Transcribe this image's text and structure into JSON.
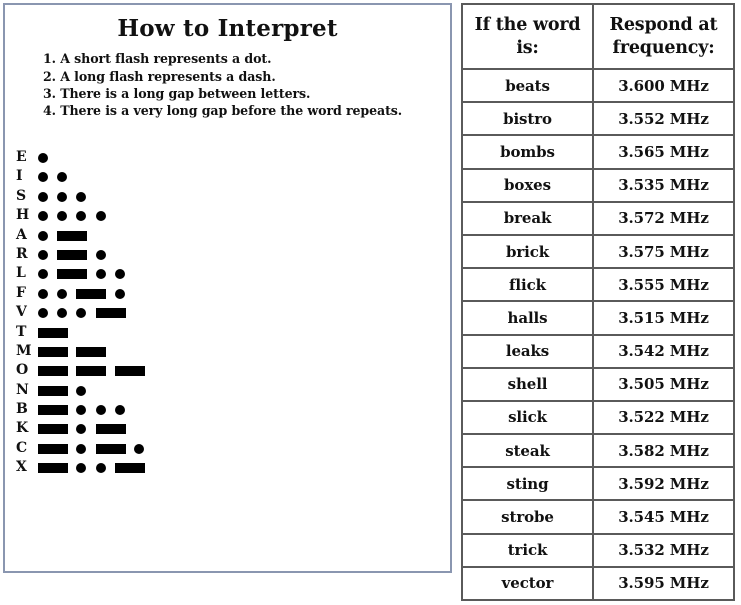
{
  "left_panel": {
    "title": "How to Interpret",
    "rules": [
      "1. A short flash represents a dot.",
      "2. A long flash represents a dash.",
      "3. There is a long gap between letters.",
      "4. There is a very long gap before the word repeats."
    ],
    "morse_chart": [
      {
        "letter": "E",
        "code": "."
      },
      {
        "letter": "I",
        "code": ".."
      },
      {
        "letter": "S",
        "code": "..."
      },
      {
        "letter": "H",
        "code": "...."
      },
      {
        "letter": "A",
        "code": ".-"
      },
      {
        "letter": "R",
        "code": ".-."
      },
      {
        "letter": "L",
        "code": ".-.."
      },
      {
        "letter": "F",
        "code": "..-."
      },
      {
        "letter": "V",
        "code": "...-"
      },
      {
        "letter": "T",
        "code": "-"
      },
      {
        "letter": "M",
        "code": "--"
      },
      {
        "letter": "O",
        "code": "---"
      },
      {
        "letter": "N",
        "code": "-."
      },
      {
        "letter": "B",
        "code": "-..."
      },
      {
        "letter": "K",
        "code": "-.-"
      },
      {
        "letter": "C",
        "code": "-.-."
      },
      {
        "letter": "X",
        "code": "-..-"
      }
    ]
  },
  "frequency_table": {
    "headers": {
      "word": "If the word is:",
      "frequency": "Respond at frequency:"
    },
    "rows": [
      {
        "word": "beats",
        "frequency": "3.600 MHz"
      },
      {
        "word": "bistro",
        "frequency": "3.552 MHz"
      },
      {
        "word": "bombs",
        "frequency": "3.565 MHz"
      },
      {
        "word": "boxes",
        "frequency": "3.535 MHz"
      },
      {
        "word": "break",
        "frequency": "3.572 MHz"
      },
      {
        "word": "brick",
        "frequency": "3.575 MHz"
      },
      {
        "word": "flick",
        "frequency": "3.555 MHz"
      },
      {
        "word": "halls",
        "frequency": "3.515 MHz"
      },
      {
        "word": "leaks",
        "frequency": "3.542 MHz"
      },
      {
        "word": "shell",
        "frequency": "3.505 MHz"
      },
      {
        "word": "slick",
        "frequency": "3.522 MHz"
      },
      {
        "word": "steak",
        "frequency": "3.582 MHz"
      },
      {
        "word": "sting",
        "frequency": "3.592 MHz"
      },
      {
        "word": "strobe",
        "frequency": "3.545 MHz"
      },
      {
        "word": "trick",
        "frequency": "3.532 MHz"
      },
      {
        "word": "vector",
        "frequency": "3.595 MHz"
      }
    ]
  },
  "colors": {
    "panel_border": "#8a96b0",
    "table_border": "#5a5a5a",
    "ink": "#111111",
    "symbol": "#000000",
    "background": "#ffffff"
  }
}
